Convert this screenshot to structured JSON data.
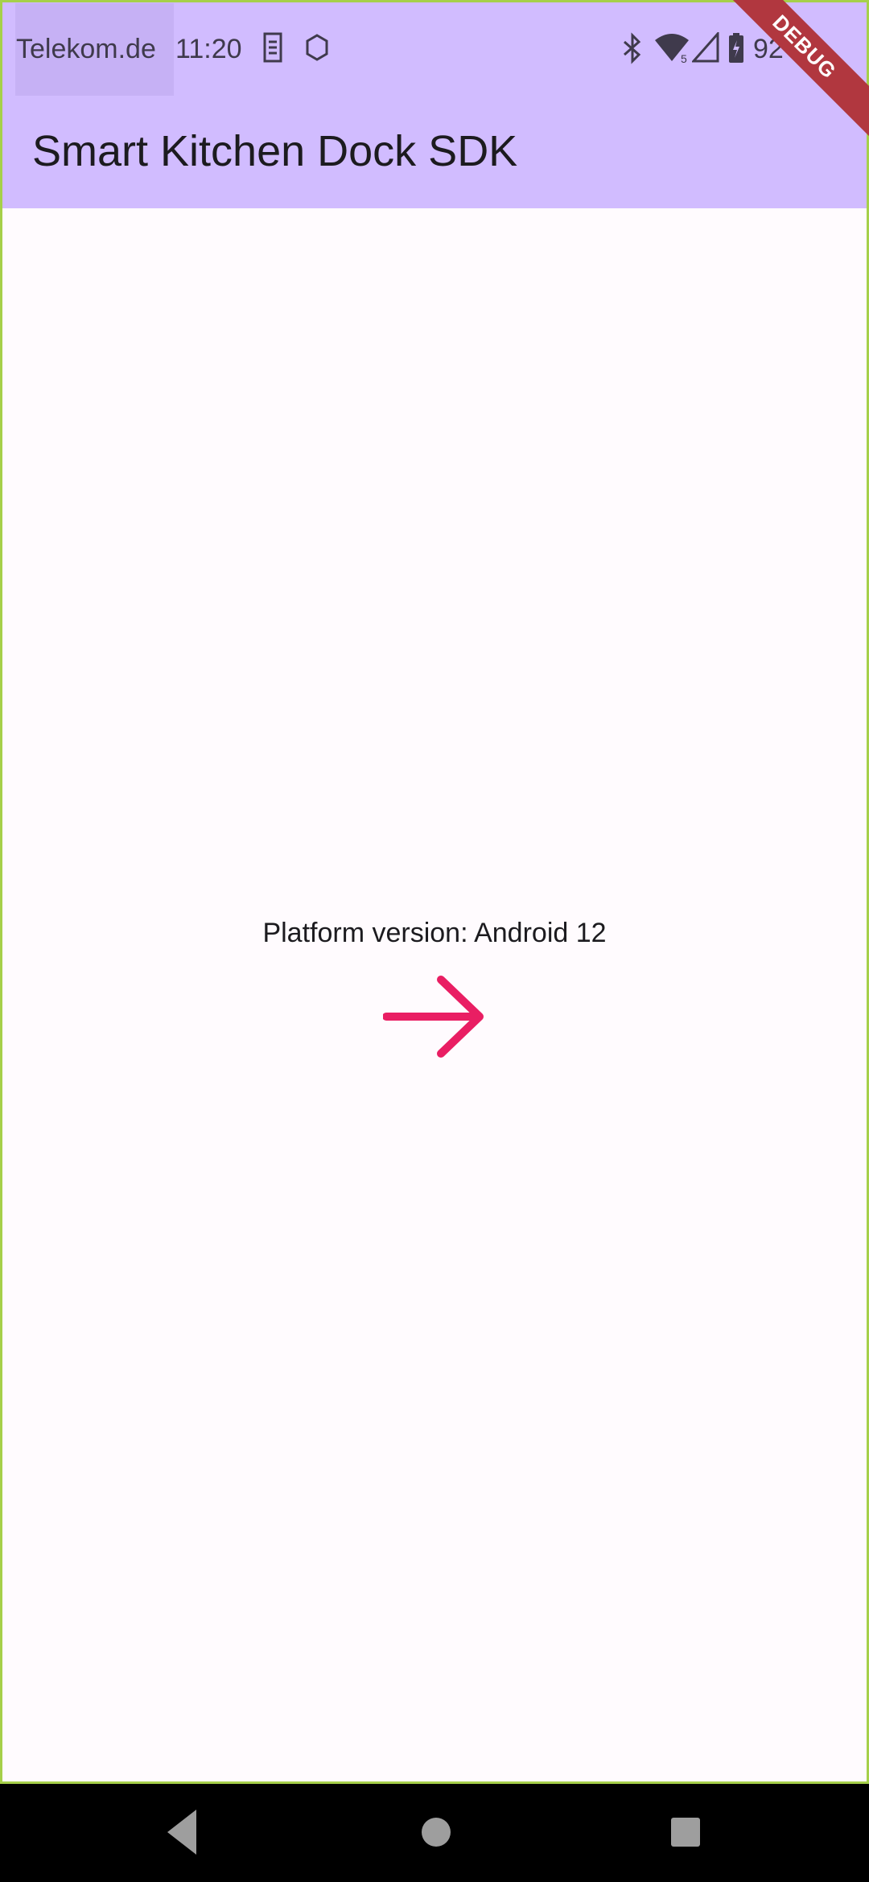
{
  "status_bar": {
    "carrier": "Telekom.de",
    "time": "11:20",
    "network_badge": "5",
    "battery": "92 %",
    "icons": [
      "sim-icon",
      "hexagon-icon",
      "bluetooth-icon",
      "wifi-icon",
      "signal-icon",
      "battery-icon"
    ]
  },
  "app_bar": {
    "title": "Smart Kitchen Dock SDK",
    "background": "#d1bcff"
  },
  "debug_banner": "DEBUG",
  "content": {
    "platform_text": "Platform version: Android 12",
    "arrow_icon": "arrow-forward-icon",
    "arrow_color": "#e91e63"
  },
  "nav_bar": {
    "buttons": [
      "back-icon",
      "home-icon",
      "recents-icon"
    ]
  }
}
